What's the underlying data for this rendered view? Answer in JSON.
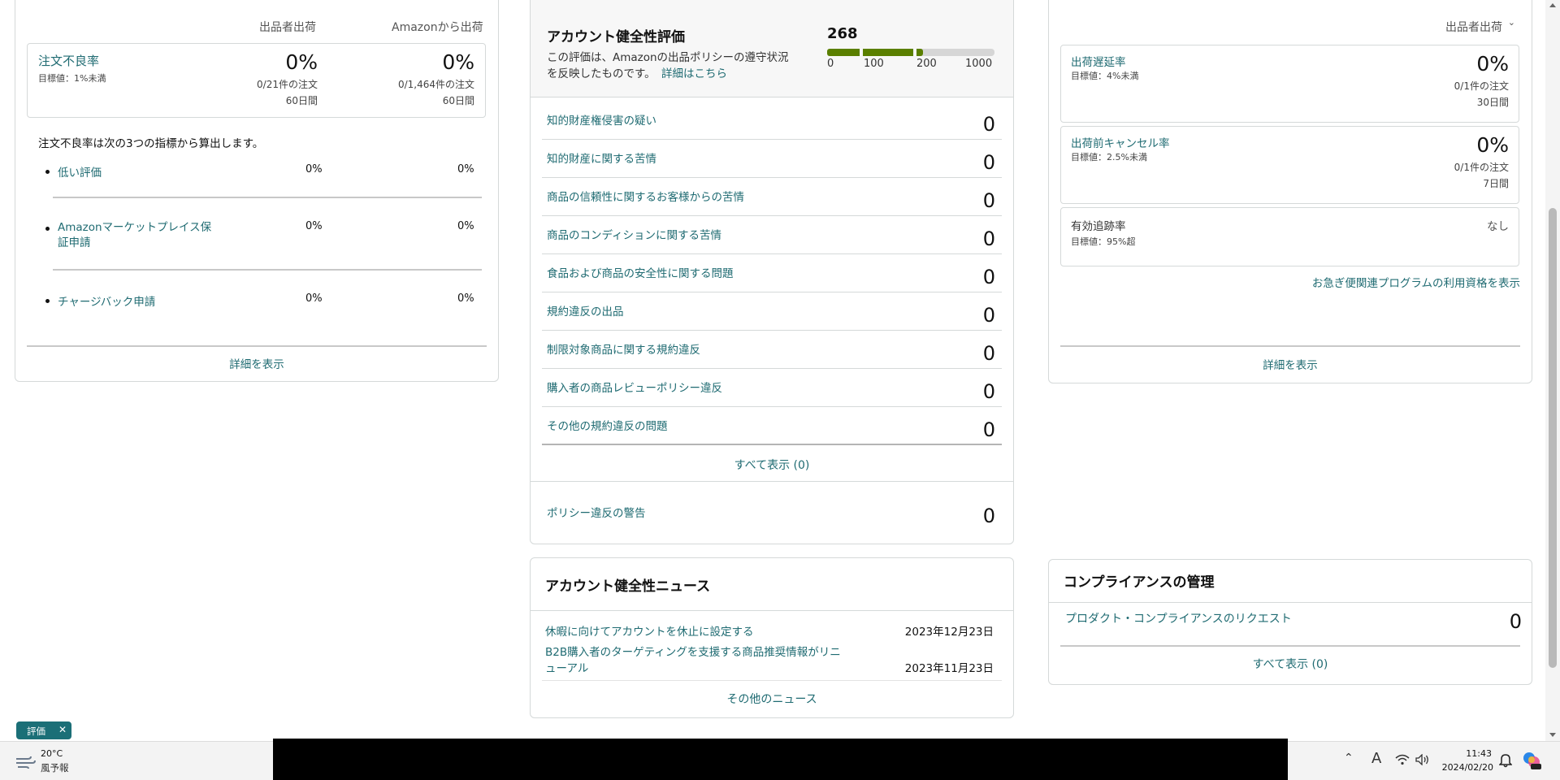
{
  "left_card": {
    "col_seller": "出品者出荷",
    "col_amazon": "Amazonから出荷",
    "odr_title": "注文不良率",
    "odr_target": "目標値：1%未満",
    "seller_pct": "0%",
    "seller_count": "0/21件の注文",
    "seller_period": "60日間",
    "amazon_pct": "0%",
    "amazon_count": "0/1,464件の注文",
    "amazon_period": "60日間",
    "description": "注文不良率は次の3つの指標から算出します。",
    "metrics": [
      {
        "label": "低い評価",
        "seller": "0%",
        "amazon": "0%"
      },
      {
        "label": "Amazonマーケットプレイス保証申請",
        "seller": "0%",
        "amazon": "0%"
      },
      {
        "label": "チャージバック申請",
        "seller": "0%",
        "amazon": "0%"
      }
    ],
    "details_link": "詳細を表示"
  },
  "mid_card": {
    "title": "アカウント健全性評価",
    "desc_line1": "この評価は、Amazonの出品ポリシーの遵守状況",
    "desc_line2": "を反映したものです。",
    "desc_link": "詳細はこちら",
    "score": "268",
    "score_value": 268,
    "scale": [
      "0",
      "100",
      "200",
      "1000"
    ],
    "colors": {
      "good": "#5a7f00",
      "track": "#d6d6d6"
    },
    "rows": [
      {
        "label": "知的財産権侵害の疑い",
        "value": "0"
      },
      {
        "label": "知的財産に関する苦情",
        "value": "0"
      },
      {
        "label": "商品の信頼性に関するお客様からの苦情",
        "value": "0"
      },
      {
        "label": "商品のコンディションに関する苦情",
        "value": "0"
      },
      {
        "label": "食品および商品の安全性に関する問題",
        "value": "0"
      },
      {
        "label": "規約違反の出品",
        "value": "0"
      },
      {
        "label": "制限対象商品に関する規約違反",
        "value": "0"
      },
      {
        "label": "購入者の商品レビューポリシー違反",
        "value": "0"
      },
      {
        "label": "その他の規約違反の問題",
        "value": "0"
      }
    ],
    "show_all": "すべて表示 (0)",
    "warning_label": "ポリシー違反の警告",
    "warning_value": "0"
  },
  "right_card": {
    "dropdown": "出品者出荷",
    "metrics": [
      {
        "title": "出荷遅延率",
        "target": "目標値：4%未満",
        "pct": "0%",
        "count": "0/1件の注文",
        "period": "30日間"
      },
      {
        "title": "出荷前キャンセル率",
        "target": "目標値：2.5%未満",
        "pct": "0%",
        "count": "0/1件の注文",
        "period": "7日間"
      }
    ],
    "tracking_title": "有効追跡率",
    "tracking_target": "目標値：95%超",
    "tracking_value": "なし",
    "program_link": "お急ぎ便関連プログラムの利用資格を表示",
    "details_link": "詳細を表示"
  },
  "news_card": {
    "title": "アカウント健全性ニュース",
    "items": [
      {
        "text": "休暇に向けてアカウントを休止に設定する",
        "date": "2023年12月23日"
      },
      {
        "text_line1": "B2B購入者のターゲティングを支援する商品推奨情報がリニ",
        "text_line2": "ューアル",
        "date": "2023年11月23日"
      }
    ],
    "more_link": "その他のニュース"
  },
  "compliance_card": {
    "title": "コンプライアンスの管理",
    "row_label": "プロダクト・コンプライアンスのリクエスト",
    "row_value": "0",
    "show_all": "すべて表示 (0)"
  },
  "chip": {
    "label": "評価"
  },
  "taskbar": {
    "weather_temp": "20°C",
    "weather_desc": "風予報",
    "ime": "A",
    "time": "11:43",
    "date": "2024/02/20"
  }
}
